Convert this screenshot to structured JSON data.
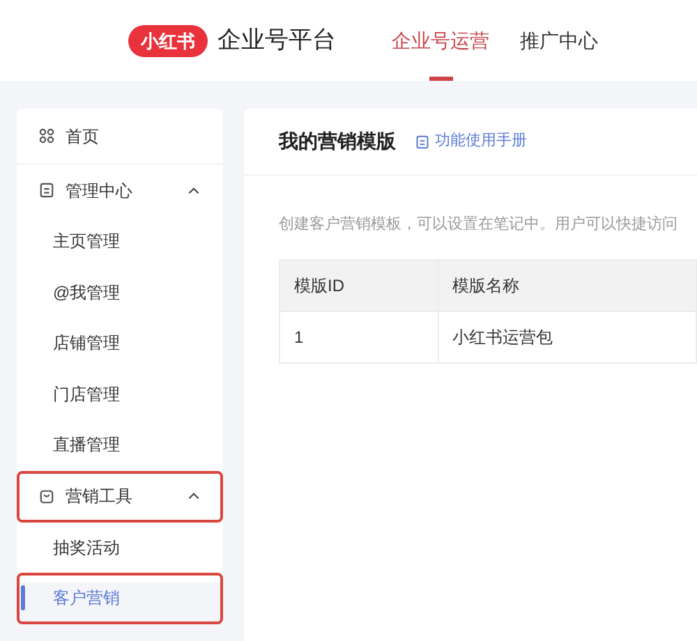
{
  "header": {
    "logo": "小红书",
    "title": "企业号平台",
    "tabs": [
      {
        "label": "企业号运营",
        "selected": true
      },
      {
        "label": "推广中心",
        "selected": false
      }
    ]
  },
  "sidebar": {
    "items": [
      {
        "label": "首页",
        "selected": false,
        "annotated": false
      },
      {
        "label": "管理中心",
        "expanded": true,
        "selected": false,
        "annotated": false,
        "children": [
          {
            "label": "主页管理",
            "selected": false,
            "annotated": false
          },
          {
            "label": "@我管理",
            "selected": false,
            "annotated": false
          },
          {
            "label": "店铺管理",
            "selected": false,
            "annotated": false
          },
          {
            "label": "门店管理",
            "selected": false,
            "annotated": false
          },
          {
            "label": "直播管理",
            "selected": false,
            "annotated": false
          }
        ]
      },
      {
        "label": "营销工具",
        "expanded": true,
        "selected": false,
        "annotated": true,
        "children": [
          {
            "label": "抽奖活动",
            "selected": false,
            "annotated": false
          },
          {
            "label": "客户营销",
            "selected": true,
            "annotated": true
          }
        ]
      }
    ]
  },
  "main": {
    "title": "我的营销模版",
    "help_link": "功能使用手册",
    "description": "创建客户营销模板，可以设置在笔记中。用户可以快捷访问",
    "table": {
      "columns": [
        "模版ID",
        "模版名称"
      ],
      "rows": [
        [
          "1",
          "小红书运营包"
        ]
      ]
    }
  }
}
